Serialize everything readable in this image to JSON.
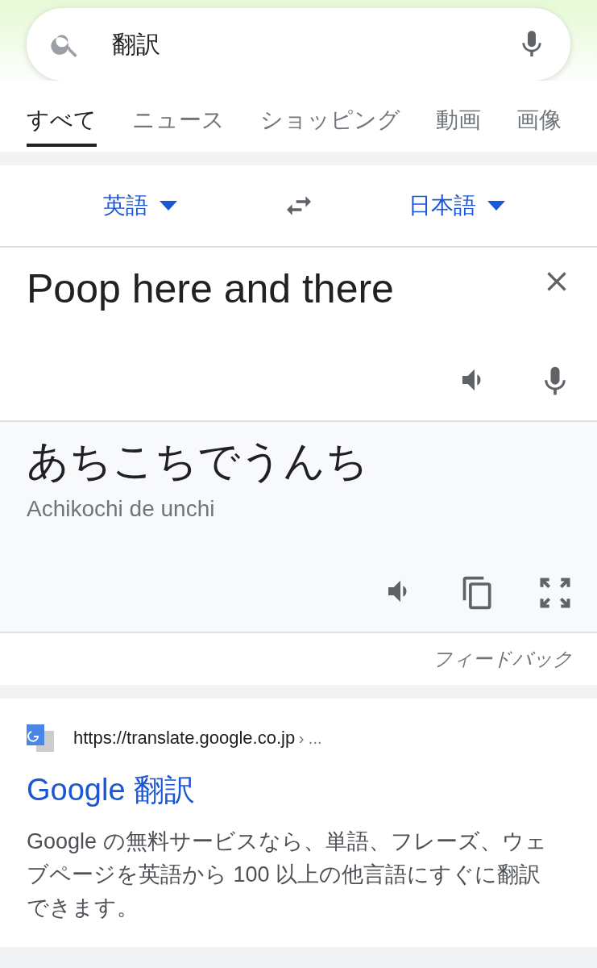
{
  "search": {
    "value": "翻訳"
  },
  "tabs": [
    {
      "label": "すべて",
      "selected": true
    },
    {
      "label": "ニュース",
      "selected": false
    },
    {
      "label": "ショッピング",
      "selected": false
    },
    {
      "label": "動画",
      "selected": false
    },
    {
      "label": "画像",
      "selected": false
    }
  ],
  "translator": {
    "source_language": "英語",
    "target_language": "日本語",
    "input": "Poop here and there",
    "output": "あちこちでうんち",
    "romanization": "Achikochi de unchi",
    "feedback": "フィードバック"
  },
  "result": {
    "url": "https://translate.google.co.jp",
    "breadcrumb": "› ...",
    "title": "Google 翻訳",
    "snippet": "Google の無料サービスなら、単語、フレーズ、ウェブページを英語から 100 以上の他言語にすぐに翻訳できます。"
  }
}
